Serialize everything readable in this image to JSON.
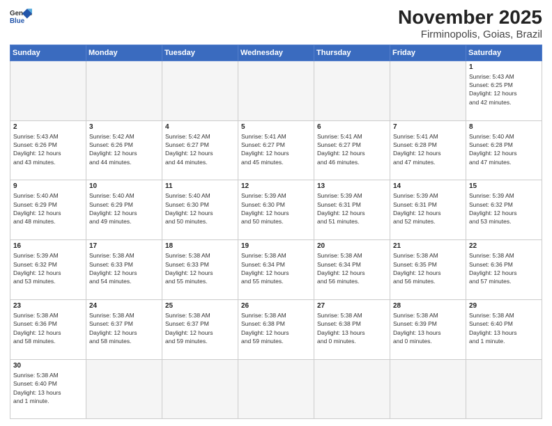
{
  "header": {
    "logo_line1": "General",
    "logo_line2": "Blue",
    "title": "November 2025",
    "subtitle": "Firminopolis, Goias, Brazil"
  },
  "weekdays": [
    "Sunday",
    "Monday",
    "Tuesday",
    "Wednesday",
    "Thursday",
    "Friday",
    "Saturday"
  ],
  "weeks": [
    [
      {
        "day": "",
        "info": ""
      },
      {
        "day": "",
        "info": ""
      },
      {
        "day": "",
        "info": ""
      },
      {
        "day": "",
        "info": ""
      },
      {
        "day": "",
        "info": ""
      },
      {
        "day": "",
        "info": ""
      },
      {
        "day": "1",
        "info": "Sunrise: 5:43 AM\nSunset: 6:25 PM\nDaylight: 12 hours\nand 42 minutes."
      }
    ],
    [
      {
        "day": "2",
        "info": "Sunrise: 5:43 AM\nSunset: 6:26 PM\nDaylight: 12 hours\nand 43 minutes."
      },
      {
        "day": "3",
        "info": "Sunrise: 5:42 AM\nSunset: 6:26 PM\nDaylight: 12 hours\nand 44 minutes."
      },
      {
        "day": "4",
        "info": "Sunrise: 5:42 AM\nSunset: 6:27 PM\nDaylight: 12 hours\nand 44 minutes."
      },
      {
        "day": "5",
        "info": "Sunrise: 5:41 AM\nSunset: 6:27 PM\nDaylight: 12 hours\nand 45 minutes."
      },
      {
        "day": "6",
        "info": "Sunrise: 5:41 AM\nSunset: 6:27 PM\nDaylight: 12 hours\nand 46 minutes."
      },
      {
        "day": "7",
        "info": "Sunrise: 5:41 AM\nSunset: 6:28 PM\nDaylight: 12 hours\nand 47 minutes."
      },
      {
        "day": "8",
        "info": "Sunrise: 5:40 AM\nSunset: 6:28 PM\nDaylight: 12 hours\nand 47 minutes."
      }
    ],
    [
      {
        "day": "9",
        "info": "Sunrise: 5:40 AM\nSunset: 6:29 PM\nDaylight: 12 hours\nand 48 minutes."
      },
      {
        "day": "10",
        "info": "Sunrise: 5:40 AM\nSunset: 6:29 PM\nDaylight: 12 hours\nand 49 minutes."
      },
      {
        "day": "11",
        "info": "Sunrise: 5:40 AM\nSunset: 6:30 PM\nDaylight: 12 hours\nand 50 minutes."
      },
      {
        "day": "12",
        "info": "Sunrise: 5:39 AM\nSunset: 6:30 PM\nDaylight: 12 hours\nand 50 minutes."
      },
      {
        "day": "13",
        "info": "Sunrise: 5:39 AM\nSunset: 6:31 PM\nDaylight: 12 hours\nand 51 minutes."
      },
      {
        "day": "14",
        "info": "Sunrise: 5:39 AM\nSunset: 6:31 PM\nDaylight: 12 hours\nand 52 minutes."
      },
      {
        "day": "15",
        "info": "Sunrise: 5:39 AM\nSunset: 6:32 PM\nDaylight: 12 hours\nand 53 minutes."
      }
    ],
    [
      {
        "day": "16",
        "info": "Sunrise: 5:39 AM\nSunset: 6:32 PM\nDaylight: 12 hours\nand 53 minutes."
      },
      {
        "day": "17",
        "info": "Sunrise: 5:38 AM\nSunset: 6:33 PM\nDaylight: 12 hours\nand 54 minutes."
      },
      {
        "day": "18",
        "info": "Sunrise: 5:38 AM\nSunset: 6:33 PM\nDaylight: 12 hours\nand 55 minutes."
      },
      {
        "day": "19",
        "info": "Sunrise: 5:38 AM\nSunset: 6:34 PM\nDaylight: 12 hours\nand 55 minutes."
      },
      {
        "day": "20",
        "info": "Sunrise: 5:38 AM\nSunset: 6:34 PM\nDaylight: 12 hours\nand 56 minutes."
      },
      {
        "day": "21",
        "info": "Sunrise: 5:38 AM\nSunset: 6:35 PM\nDaylight: 12 hours\nand 56 minutes."
      },
      {
        "day": "22",
        "info": "Sunrise: 5:38 AM\nSunset: 6:36 PM\nDaylight: 12 hours\nand 57 minutes."
      }
    ],
    [
      {
        "day": "23",
        "info": "Sunrise: 5:38 AM\nSunset: 6:36 PM\nDaylight: 12 hours\nand 58 minutes."
      },
      {
        "day": "24",
        "info": "Sunrise: 5:38 AM\nSunset: 6:37 PM\nDaylight: 12 hours\nand 58 minutes."
      },
      {
        "day": "25",
        "info": "Sunrise: 5:38 AM\nSunset: 6:37 PM\nDaylight: 12 hours\nand 59 minutes."
      },
      {
        "day": "26",
        "info": "Sunrise: 5:38 AM\nSunset: 6:38 PM\nDaylight: 12 hours\nand 59 minutes."
      },
      {
        "day": "27",
        "info": "Sunrise: 5:38 AM\nSunset: 6:38 PM\nDaylight: 13 hours\nand 0 minutes."
      },
      {
        "day": "28",
        "info": "Sunrise: 5:38 AM\nSunset: 6:39 PM\nDaylight: 13 hours\nand 0 minutes."
      },
      {
        "day": "29",
        "info": "Sunrise: 5:38 AM\nSunset: 6:40 PM\nDaylight: 13 hours\nand 1 minute."
      }
    ],
    [
      {
        "day": "30",
        "info": "Sunrise: 5:38 AM\nSunset: 6:40 PM\nDaylight: 13 hours\nand 1 minute."
      },
      {
        "day": "",
        "info": ""
      },
      {
        "day": "",
        "info": ""
      },
      {
        "day": "",
        "info": ""
      },
      {
        "day": "",
        "info": ""
      },
      {
        "day": "",
        "info": ""
      },
      {
        "day": "",
        "info": ""
      }
    ]
  ]
}
